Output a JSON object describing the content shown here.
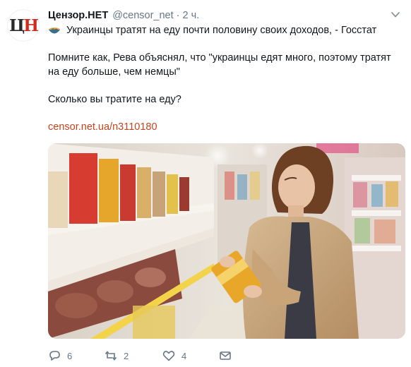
{
  "tweet": {
    "avatar_logo": [
      "Ц",
      "Н"
    ],
    "author_name": "Цензор.НЕТ",
    "author_handle": "@censor_net",
    "separator": "·",
    "time": "2 ч.",
    "headline": "Украинцы тратят на еду почти половину своих доходов, - Госстат",
    "paragraph_1": "Помните как, Рева объяснял, что \"украинцы едят много, поэтому тратят на еду больше, чем немцы\"",
    "paragraph_2": "Сколько вы тратите на еду?",
    "link": "censor.net.ua/n3110180",
    "actions": {
      "reply_count": "6",
      "retweet_count": "2",
      "like_count": "4"
    }
  },
  "colors": {
    "link": "#c44420",
    "muted": "#657786",
    "logo_red": "#d12a1f"
  },
  "icons": [
    "caret-down-icon",
    "bowl-emoji-icon",
    "reply-icon",
    "retweet-icon",
    "like-icon",
    "message-icon"
  ]
}
